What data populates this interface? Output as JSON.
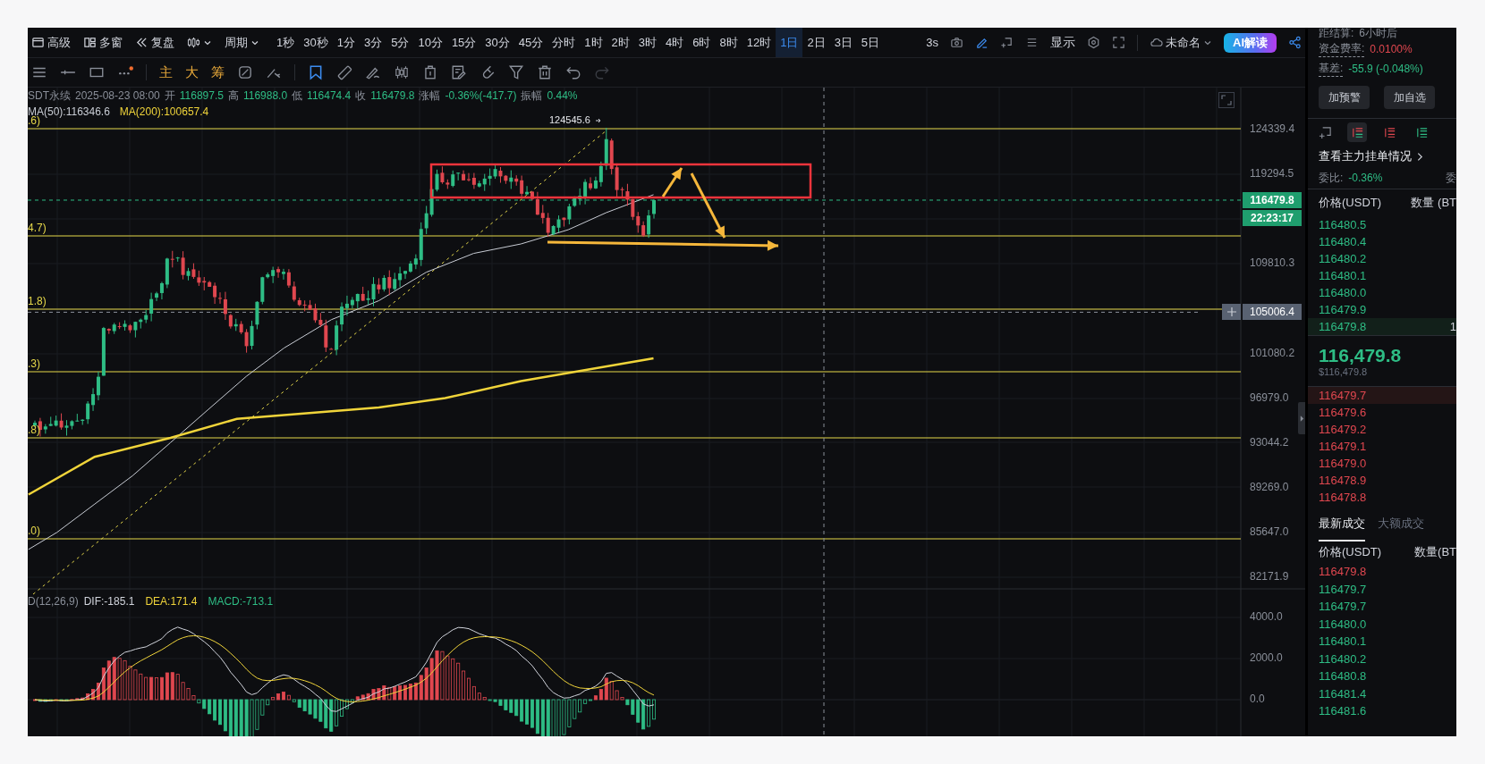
{
  "toolbar": {
    "menus": [
      {
        "kind": "advanced",
        "label": "高级"
      },
      {
        "kind": "windows",
        "label": "多窗"
      },
      {
        "kind": "replay",
        "label": "复盘"
      }
    ],
    "period": "周期",
    "intervals": [
      {
        "label": "1秒",
        "selected": false
      },
      {
        "label": "30秒",
        "selected": false
      },
      {
        "label": "1分",
        "selected": false
      },
      {
        "label": "3分",
        "selected": false
      },
      {
        "label": "5分",
        "selected": false
      },
      {
        "label": "10分",
        "selected": false
      },
      {
        "label": "15分",
        "selected": false
      },
      {
        "label": "30分",
        "selected": false
      },
      {
        "label": "45分",
        "selected": false
      },
      {
        "label": "分时",
        "selected": false
      },
      {
        "label": "1时",
        "selected": false
      },
      {
        "label": "2时",
        "selected": false
      },
      {
        "label": "3时",
        "selected": false
      },
      {
        "label": "4时",
        "selected": false
      },
      {
        "label": "6时",
        "selected": false
      },
      {
        "label": "8时",
        "selected": false
      },
      {
        "label": "12时",
        "selected": false
      },
      {
        "label": "1日",
        "selected": true
      },
      {
        "label": "2日",
        "selected": false
      },
      {
        "label": "3日",
        "selected": false
      },
      {
        "label": "5日",
        "selected": false
      }
    ],
    "refresh": "3s",
    "display": "显示",
    "layout_name": "未命名",
    "ai_button": "AI解读"
  },
  "drawing_bar": {
    "shortcuts": [
      "主",
      "大",
      "筹"
    ],
    "redo_disabled": true
  },
  "chart": {
    "symbol": "SDT永续",
    "time": "2025-08-23 08:00",
    "ohlc": [
      {
        "label": "开",
        "value": "116897.5"
      },
      {
        "label": "高",
        "value": "116988.0"
      },
      {
        "label": "低",
        "value": "116474.4"
      },
      {
        "label": "收",
        "value": "116479.8"
      },
      {
        "label": "涨幅",
        "value": "-0.36%(-417.7)"
      },
      {
        "label": "振幅",
        "value": "0.44%"
      }
    ],
    "ma": [
      {
        "text": "MA(50):116346.6",
        "color": "#c8ccd4"
      },
      {
        "text": "MA(200):100657.4",
        "color": "#f0d43a"
      }
    ],
    "levels": [
      ".6)",
      "4.7)",
      "1.8)",
      ".3)",
      ".8)",
      ".0)"
    ],
    "price_ticks": [
      "124339.4",
      "119294.5",
      "109810.3",
      "101080.2",
      "96979.0",
      "93044.2",
      "89269.0",
      "85647.0",
      "82171.9"
    ],
    "last_price": "116479.8",
    "countdown": "22:23:17",
    "crosshair_price": "105006.4",
    "peak_label": "124545.6",
    "macd": {
      "title": "D(12,26,9)",
      "items": [
        {
          "text": "DIF:-185.1",
          "color": "#d1d4dc"
        },
        {
          "text": "DEA:171.4",
          "color": "#f0d43a"
        },
        {
          "text": "MACD:-713.1",
          "color": "#2ebd85"
        }
      ],
      "ticks": [
        "4000.0",
        "2000.0",
        "0.0"
      ]
    }
  },
  "sidebar": {
    "settlement": {
      "label": "距结算:",
      "value": "6小时后"
    },
    "funding": {
      "label": "资金费率:",
      "value": "0.0100%"
    },
    "basis": {
      "label": "基差:",
      "value": "-55.9 (-0.048%)"
    },
    "buttons": [
      "加预警",
      "加自选"
    ],
    "view_modes": [
      {
        "kind": "add",
        "selected": false
      },
      {
        "kind": "both",
        "selected": true
      },
      {
        "kind": "asks",
        "selected": false
      },
      {
        "kind": "bids",
        "selected": false
      }
    ],
    "depth_link": "查看主力挂单情况",
    "ratio": {
      "label": "委比:",
      "value": "-0.36%",
      "cut_label": "委"
    },
    "book": {
      "headers": [
        "价格(USDT)",
        "数量 (BT"
      ],
      "upper": [
        {
          "price": "116480.5",
          "highlighted": false
        },
        {
          "price": "116480.4",
          "highlighted": false
        },
        {
          "price": "116480.2",
          "highlighted": false
        },
        {
          "price": "116480.1",
          "highlighted": false
        },
        {
          "price": "116480.0",
          "highlighted": false
        },
        {
          "price": "116479.9",
          "highlighted": false
        },
        {
          "price": "116479.8",
          "highlighted": true,
          "qty": "1"
        }
      ],
      "mid_price": "116,479.8",
      "mid_usd": "$116,479.8",
      "lower": [
        {
          "price": "116479.7",
          "highlighted": true
        },
        {
          "price": "116479.6",
          "highlighted": false
        },
        {
          "price": "116479.2",
          "highlighted": false
        },
        {
          "price": "116479.1",
          "highlighted": false
        },
        {
          "price": "116479.0",
          "highlighted": false
        },
        {
          "price": "116478.9",
          "highlighted": false
        },
        {
          "price": "116478.8",
          "highlighted": false
        }
      ]
    },
    "trade_tabs": [
      {
        "label": "最新成交",
        "selected": true
      },
      {
        "label": "大额成交",
        "selected": false
      }
    ],
    "trade_headers": [
      "价格(USDT)",
      "数量(BT"
    ],
    "trades": [
      {
        "price": "116479.8",
        "color": "#e0474f"
      },
      {
        "price": "116479.7",
        "color": "#2ebd85"
      },
      {
        "price": "116479.7",
        "color": "#2ebd85"
      },
      {
        "price": "116480.0",
        "color": "#2ebd85"
      },
      {
        "price": "116480.1",
        "color": "#2ebd85"
      },
      {
        "price": "116480.2",
        "color": "#2ebd85"
      },
      {
        "price": "116480.8",
        "color": "#2ebd85"
      },
      {
        "price": "116481.4",
        "color": "#2ebd85"
      },
      {
        "price": "116481.6",
        "color": "#2ebd85"
      }
    ]
  }
}
